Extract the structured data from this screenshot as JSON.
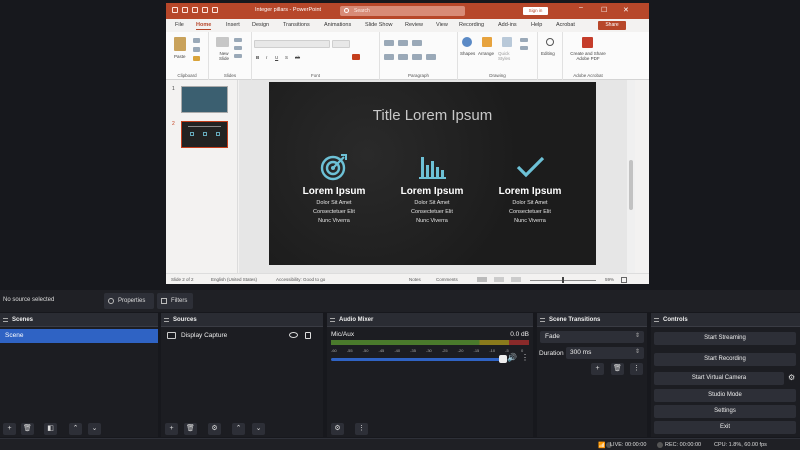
{
  "ppt": {
    "title": "Integer pillars  -  PowerPoint",
    "search_placeholder": "Search",
    "sign_in": "Sign in",
    "tabs": [
      "File",
      "Home",
      "Insert",
      "Design",
      "Transitions",
      "Animations",
      "Slide Show",
      "Review",
      "View",
      "Recording",
      "Add-ins",
      "Help",
      "Acrobat"
    ],
    "active_tab": "Home",
    "share": "Share",
    "ribbon_groups": [
      "Clipboard",
      "Slides",
      "Font",
      "Paragraph",
      "Drawing",
      "Adobe Acrobat"
    ],
    "ribbon_labels": {
      "paste": "Paste",
      "new_slide": "New Slide",
      "shapes": "Shapes",
      "arrange": "Arrange",
      "quick_styles": "Quick Styles",
      "editing": "Editing",
      "create_share": "Create and Share Adobe PDF"
    },
    "thumbnails": [
      "1",
      "2"
    ],
    "slide": {
      "title": "Title Lorem Ipsum",
      "columns": [
        {
          "icon": "target-icon",
          "heading": "Lorem Ipsum",
          "lines": [
            "Dolor Sit Amet",
            "Consectetuer Elit",
            "Nunc Viverra"
          ]
        },
        {
          "icon": "bar-chart-icon",
          "heading": "Lorem Ipsum",
          "lines": [
            "Dolor Sit Amet",
            "Consectetuer Elit",
            "Nunc Viverra"
          ]
        },
        {
          "icon": "checkmark-icon",
          "heading": "Lorem Ipsum",
          "lines": [
            "Dolor Sit Amet",
            "Consectetuer Elit",
            "Nunc Viverra"
          ]
        }
      ]
    },
    "status": {
      "slide_of": "Slide 2 of 2",
      "language": "English (United States)",
      "accessibility": "Accessibility: Good to go",
      "notes": "Notes",
      "comments": "Comments",
      "zoom": "59%"
    }
  },
  "obs": {
    "context": {
      "no_source": "No source selected",
      "properties": "Properties",
      "filters": "Filters"
    },
    "docks": {
      "scenes": {
        "title": "Scenes",
        "items": [
          "Scene"
        ]
      },
      "sources": {
        "title": "Sources",
        "items": [
          "Display Capture"
        ]
      },
      "mixer": {
        "title": "Audio Mixer",
        "channel": "Mic/Aux",
        "level": "0.0 dB",
        "ticks": [
          "-60",
          "-55",
          "-50",
          "-45",
          "-40",
          "-35",
          "-30",
          "-25",
          "-20",
          "-15",
          "-10",
          "-5",
          "0"
        ],
        "volume": 1.0
      },
      "transitions": {
        "title": "Scene Transitions",
        "transition": "Fade",
        "duration_label": "Duration",
        "duration": "300 ms"
      },
      "controls": {
        "title": "Controls",
        "buttons": [
          "Start Streaming",
          "Start Recording",
          "Start Virtual Camera",
          "Studio Mode",
          "Settings",
          "Exit"
        ]
      }
    },
    "status": {
      "live": "LIVE: 00:00:00",
      "rec": "REC: 00:00:00",
      "cpu": "CPU: 1.8%, 60.00 fps"
    }
  }
}
